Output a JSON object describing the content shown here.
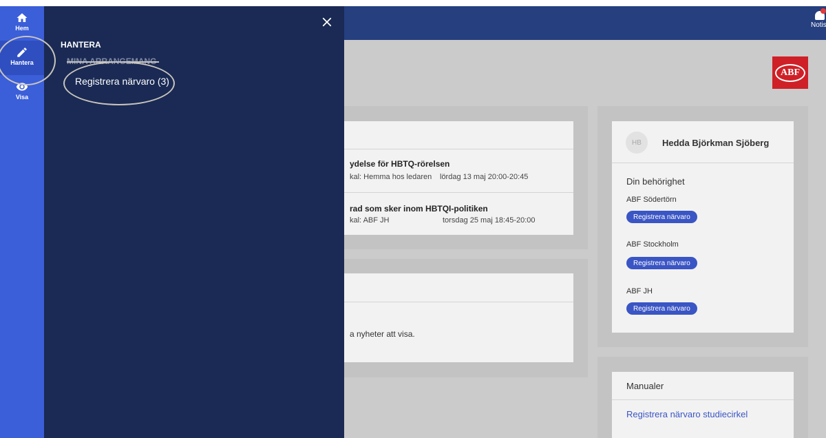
{
  "rail": {
    "items": [
      {
        "label": "Hem",
        "icon": "home-icon"
      },
      {
        "label": "Hantera",
        "icon": "pencil-icon"
      },
      {
        "label": "Visa",
        "icon": "eye-icon"
      }
    ]
  },
  "drawer": {
    "heading": "HANTERA",
    "section": "MINA ARRANGEMANG",
    "link": "Registrera närvaro (3)"
  },
  "topbar": {
    "notis_label": "Notis"
  },
  "logo": {
    "text": "ABF",
    "color": "#cf2027"
  },
  "events": [
    {
      "title": "ydelse för HBTQ-rörelsen",
      "place": "kal: Hemma hos ledaren",
      "date": "lördag 13 maj 20:00-20:45"
    },
    {
      "title": "rad som sker inom HBTQI-politiken",
      "place": "kal: ABF JH",
      "date": "torsdag 25 maj 18:45-20:00"
    }
  ],
  "news": {
    "empty_text": "a nyheter att visa."
  },
  "profile": {
    "initials": "HB",
    "name": "Hedda Björkman Sjöberg",
    "permission_heading": "Din behörighet",
    "orgs": [
      {
        "name": "ABF Södertörn",
        "button": "Registrera närvaro"
      },
      {
        "name": "ABF Stockholm",
        "button": "Registrera närvaro"
      },
      {
        "name": "ABF JH",
        "button": "Registrera närvaro"
      }
    ]
  },
  "manuals": {
    "heading": "Manualer",
    "links": [
      "Registrera närvaro studiecirkel"
    ]
  },
  "colors": {
    "drawer": "#1a2a54",
    "rail": "#3b5ed9",
    "topbar": "#253f7f",
    "accent": "#3a55c4"
  }
}
